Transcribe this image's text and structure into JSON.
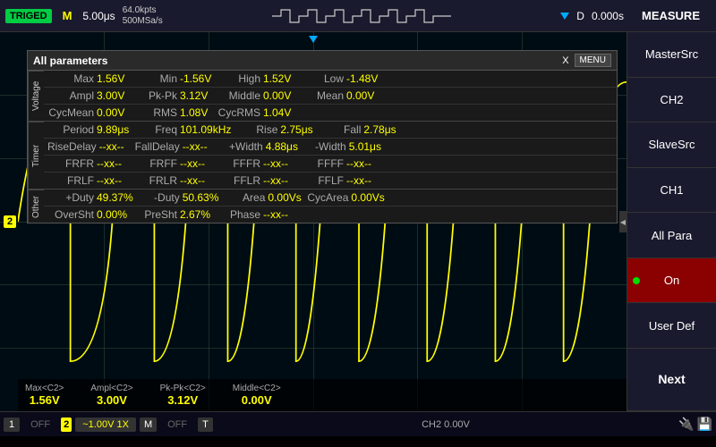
{
  "topbar": {
    "triged": "TRIGED",
    "m_label": "M",
    "time_div": "5.00μs",
    "pts1": "64.0kpts",
    "pts2": "500MSa/s",
    "d_label": "D",
    "offset": "0.000s",
    "measure_label": "MEASURE"
  },
  "sidebar": {
    "items": [
      {
        "id": "master-src",
        "label": "MasterSrc",
        "active": false
      },
      {
        "id": "ch2",
        "label": "CH2",
        "active": false
      },
      {
        "id": "slave-src",
        "label": "SlaveSrc",
        "active": false
      },
      {
        "id": "ch1",
        "label": "CH1",
        "active": false
      },
      {
        "id": "all-para",
        "label": "All Para",
        "active": false
      },
      {
        "id": "on",
        "label": "On",
        "active": true
      },
      {
        "id": "user-def",
        "label": "User Def",
        "active": false
      },
      {
        "id": "next",
        "label": "Next",
        "active": false,
        "isNext": true
      }
    ]
  },
  "params_panel": {
    "title": "All parameters",
    "menu_label": "MENU",
    "close_label": "X",
    "voltage_label": "Voltage",
    "timer_label": "Timer",
    "other_label": "Other",
    "rows": {
      "voltage": [
        [
          {
            "name": "Max",
            "value": "1.56V"
          },
          {
            "name": "Min",
            "value": "-1.56V"
          },
          {
            "name": "High",
            "value": "1.52V"
          },
          {
            "name": "Low",
            "value": "-1.48V"
          }
        ],
        [
          {
            "name": "Ampl",
            "value": "3.00V"
          },
          {
            "name": "Pk-Pk",
            "value": "3.12V"
          },
          {
            "name": "Middle",
            "value": "0.00V"
          },
          {
            "name": "Mean",
            "value": "0.00V"
          }
        ],
        [
          {
            "name": "CycMean",
            "value": "0.00V"
          },
          {
            "name": "RMS",
            "value": "1.08V"
          },
          {
            "name": "CycRMS",
            "value": "1.04V"
          }
        ]
      ],
      "timer": [
        [
          {
            "name": "Period",
            "value": "9.89μs"
          },
          {
            "name": "Freq",
            "value": "101.09kHz"
          },
          {
            "name": "Rise",
            "value": "2.75μs"
          },
          {
            "name": "Fall",
            "value": "2.78μs"
          }
        ],
        [
          {
            "name": "RiseDelay",
            "value": "--xx--"
          },
          {
            "name": "FallDelay",
            "value": "--xx--"
          },
          {
            "name": "+Width",
            "value": "4.88μs"
          },
          {
            "name": "-Width",
            "value": "5.01μs"
          }
        ],
        [
          {
            "name": "FRFR",
            "value": "--xx--"
          },
          {
            "name": "FRFF",
            "value": "--xx--"
          },
          {
            "name": "FFFR",
            "value": "--xx--"
          },
          {
            "name": "FFFF",
            "value": "--xx--"
          }
        ],
        [
          {
            "name": "FRLF",
            "value": "--xx--"
          },
          {
            "name": "FRLR",
            "value": "--xx--"
          },
          {
            "name": "FFLR",
            "value": "--xx--"
          },
          {
            "name": "FFLF",
            "value": "--xx--"
          }
        ]
      ],
      "other": [
        [
          {
            "name": "+Duty",
            "value": "49.37%"
          },
          {
            "name": "-Duty",
            "value": "50.63%"
          },
          {
            "name": "Area",
            "value": "0.00Vs"
          },
          {
            "name": "CycArea",
            "value": "0.00Vs"
          }
        ],
        [
          {
            "name": "OverSht",
            "value": "0.00%"
          },
          {
            "name": "PreSht",
            "value": "2.67%"
          },
          {
            "name": "Phase",
            "value": "--xx--"
          }
        ]
      ]
    }
  },
  "measurements": [
    {
      "label": "Max<C2>",
      "value": "1.56V"
    },
    {
      "label": "Ampl<C2>",
      "value": "3.00V"
    },
    {
      "label": "Pk-Pk<C2>",
      "value": "3.12V"
    },
    {
      "label": "Middle<C2>",
      "value": "0.00V"
    }
  ],
  "bottombar": {
    "ch1_num": "1",
    "ch1_off": "OFF",
    "ch2_num": "2",
    "ch2_setting": "~1.00V  1X",
    "m_label": "M",
    "ch2_off": "OFF",
    "t_label": "T",
    "ch2_ref": "CH2 0.00V"
  }
}
